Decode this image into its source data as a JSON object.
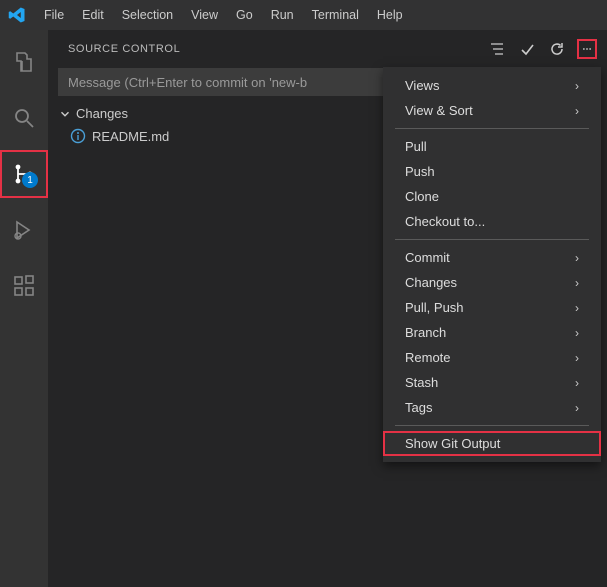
{
  "menu": [
    "File",
    "Edit",
    "Selection",
    "View",
    "Go",
    "Run",
    "Terminal",
    "Help"
  ],
  "activity": {
    "badge": "1"
  },
  "sourceControl": {
    "title": "SOURCE CONTROL",
    "commitPlaceholder": "Message (Ctrl+Enter to commit on 'new-b",
    "changesLabel": "Changes",
    "files": [
      {
        "name": "README.md"
      }
    ]
  },
  "contextMenu": {
    "groups": [
      [
        {
          "label": "Views",
          "submenu": true
        },
        {
          "label": "View & Sort",
          "submenu": true
        }
      ],
      [
        {
          "label": "Pull"
        },
        {
          "label": "Push"
        },
        {
          "label": "Clone"
        },
        {
          "label": "Checkout to..."
        }
      ],
      [
        {
          "label": "Commit",
          "submenu": true
        },
        {
          "label": "Changes",
          "submenu": true
        },
        {
          "label": "Pull, Push",
          "submenu": true
        },
        {
          "label": "Branch",
          "submenu": true
        },
        {
          "label": "Remote",
          "submenu": true
        },
        {
          "label": "Stash",
          "submenu": true
        },
        {
          "label": "Tags",
          "submenu": true
        }
      ],
      [
        {
          "label": "Show Git Output",
          "highlight": true
        }
      ]
    ]
  }
}
